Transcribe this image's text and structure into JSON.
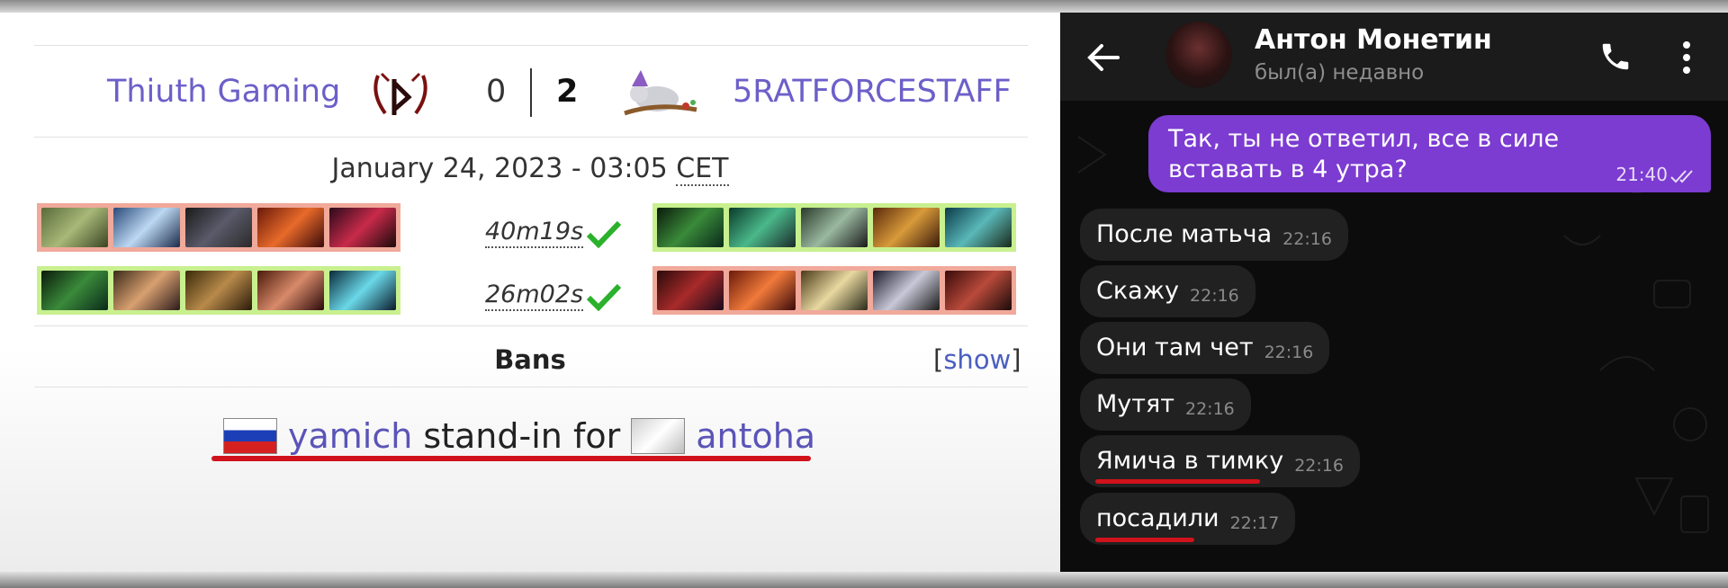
{
  "match": {
    "team_left": "Thiuth Gaming",
    "team_right": "5RATFORCESTAFF",
    "score_left": "0",
    "score_right": "2",
    "date": "January 24, 2023 - 03:05",
    "timezone": "CET",
    "games": [
      {
        "duration": "40m19s",
        "left_result": "loss",
        "right_result": "win"
      },
      {
        "duration": "26m02s",
        "left_result": "win",
        "right_result": "loss"
      }
    ],
    "bans_label": "Bans",
    "show_link": "show",
    "show_open_bracket": "[",
    "show_close_bracket": "]"
  },
  "standin": {
    "player_in": "yamich",
    "player_in_flag": "russia-flag",
    "middle_text": "stand-in for",
    "player_out": "antoha",
    "player_out_flag": "unknown-flag"
  },
  "chat": {
    "contact_name": "Антон Монетин",
    "contact_status": "был(а) недавно",
    "outgoing": {
      "text": "Так, ты не ответил, все в силе вставать в 4 утра?",
      "time": "21:40"
    },
    "incoming": [
      {
        "text": "После матьча",
        "time": "22:16"
      },
      {
        "text": "Скажу",
        "time": "22:16"
      },
      {
        "text": "Они там чет",
        "time": "22:16"
      },
      {
        "text": "Мутят",
        "time": "22:16"
      },
      {
        "text": "Ямича в тимку",
        "time": "22:16"
      },
      {
        "text": "посадили",
        "time": "22:17"
      }
    ]
  },
  "colors": {
    "team_link": "#6c5fc9",
    "pick_loss": "#f0a99a",
    "pick_win": "#c8f08f",
    "win_check": "#2bb12b",
    "highlight_underline": "#d0121b",
    "outgoing_bubble": "#7c3bd1",
    "incoming_bubble": "#212121"
  }
}
